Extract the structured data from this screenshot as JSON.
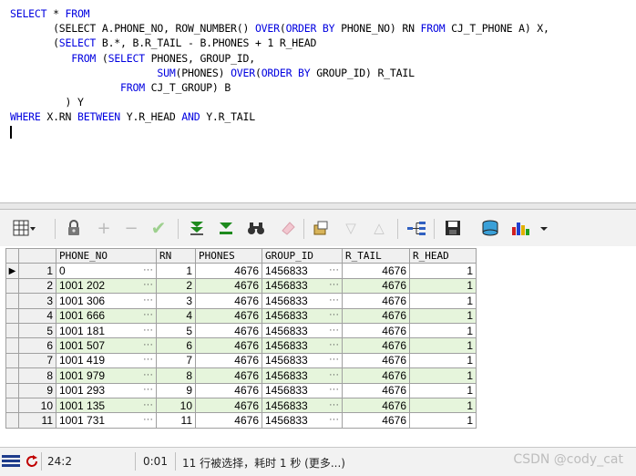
{
  "editor": {
    "lines": [
      [
        {
          "t": "SELECT",
          "k": true
        },
        {
          "t": " * "
        },
        {
          "t": "FROM",
          "k": true
        }
      ],
      [
        {
          "t": "       (SELECT A.PHONE_NO, ROW_NUMBER() "
        },
        {
          "t": "OVER",
          "k": true
        },
        {
          "t": "("
        },
        {
          "t": "ORDER BY",
          "k": true
        },
        {
          "t": " PHONE_NO) RN "
        },
        {
          "t": "FROM",
          "k": true
        },
        {
          "t": " CJ_T_PHONE A) X,"
        }
      ],
      [
        {
          "t": "       ("
        },
        {
          "t": "SELECT",
          "k": true
        },
        {
          "t": " B.*, B.R_TAIL - B.PHONES + 1 R_HEAD"
        }
      ],
      [
        {
          "t": "          "
        },
        {
          "t": "FROM",
          "k": true
        },
        {
          "t": " ("
        },
        {
          "t": "SELECT",
          "k": true
        },
        {
          "t": " PHONES, GROUP_ID,"
        }
      ],
      [
        {
          "t": "                        "
        },
        {
          "t": "SUM",
          "k": true
        },
        {
          "t": "(PHONES) "
        },
        {
          "t": "OVER",
          "k": true
        },
        {
          "t": "("
        },
        {
          "t": "ORDER BY",
          "k": true
        },
        {
          "t": " GROUP_ID) R_TAIL"
        }
      ],
      [
        {
          "t": "                  "
        },
        {
          "t": "FROM",
          "k": true
        },
        {
          "t": " CJ_T_GROUP) B"
        }
      ],
      [
        {
          "t": "         ) Y"
        }
      ],
      [
        {
          "t": "WHERE",
          "k": true
        },
        {
          "t": " X.RN "
        },
        {
          "t": "BETWEEN",
          "k": true
        },
        {
          "t": " Y.R_HEAD "
        },
        {
          "t": "AND",
          "k": true
        },
        {
          "t": " Y.R_TAIL"
        }
      ]
    ]
  },
  "colors": {
    "keyword": "#0000e0",
    "row_alt": "#e6f5dc"
  },
  "grid": {
    "columns": [
      "PHONE_NO",
      "RN",
      "PHONES",
      "GROUP_ID",
      "R_TAIL",
      "R_HEAD"
    ],
    "rows": [
      {
        "n": "1",
        "phone": "0",
        "rn": "1",
        "phones": "4676",
        "gid": "1456833",
        "rtail": "4676",
        "rhead": "1"
      },
      {
        "n": "2",
        "phone": "1001 202",
        "rn": "2",
        "phones": "4676",
        "gid": "1456833",
        "rtail": "4676",
        "rhead": "1"
      },
      {
        "n": "3",
        "phone": "1001 306",
        "rn": "3",
        "phones": "4676",
        "gid": "1456833",
        "rtail": "4676",
        "rhead": "1"
      },
      {
        "n": "4",
        "phone": "1001 666",
        "rn": "4",
        "phones": "4676",
        "gid": "1456833",
        "rtail": "4676",
        "rhead": "1"
      },
      {
        "n": "5",
        "phone": "1001 181",
        "rn": "5",
        "phones": "4676",
        "gid": "1456833",
        "rtail": "4676",
        "rhead": "1"
      },
      {
        "n": "6",
        "phone": "1001 507",
        "rn": "6",
        "phones": "4676",
        "gid": "1456833",
        "rtail": "4676",
        "rhead": "1"
      },
      {
        "n": "7",
        "phone": "1001 419",
        "rn": "7",
        "phones": "4676",
        "gid": "1456833",
        "rtail": "4676",
        "rhead": "1"
      },
      {
        "n": "8",
        "phone": "1001 979",
        "rn": "8",
        "phones": "4676",
        "gid": "1456833",
        "rtail": "4676",
        "rhead": "1"
      },
      {
        "n": "9",
        "phone": "1001 293",
        "rn": "9",
        "phones": "4676",
        "gid": "1456833",
        "rtail": "4676",
        "rhead": "1"
      },
      {
        "n": "10",
        "phone": "1001 135",
        "rn": "10",
        "phones": "4676",
        "gid": "1456833",
        "rtail": "4676",
        "rhead": "1"
      },
      {
        "n": "11",
        "phone": "1001 731",
        "rn": "11",
        "phones": "4676",
        "gid": "1456833",
        "rtail": "4676",
        "rhead": "1"
      }
    ],
    "ellipsis": "···"
  },
  "status": {
    "position": "24:2",
    "time": "0:01",
    "message": "11 行被选择，耗时 1 秒 (更多...)"
  },
  "watermark": "CSDN @cody_cat"
}
